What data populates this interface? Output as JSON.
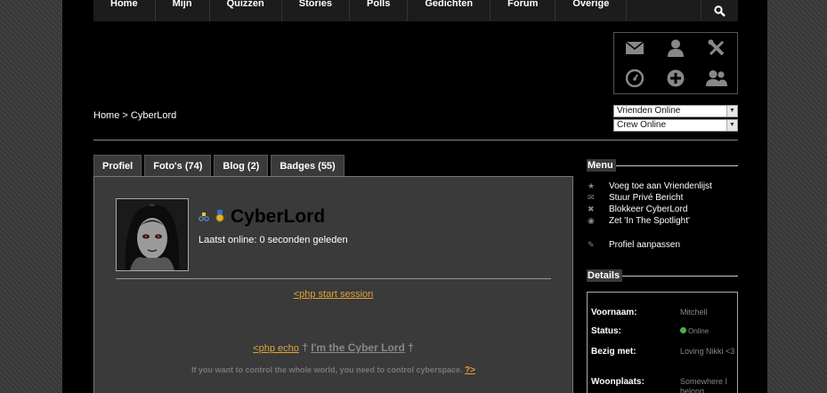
{
  "nav": {
    "items": [
      "Home",
      "Mijn",
      "Quizzen",
      "Stories",
      "Polls",
      "Gedichten",
      "Forum",
      "Overige"
    ],
    "search_icon": "search-icon"
  },
  "iconbox": {
    "icons": [
      "envelope-icon",
      "user-icon",
      "tools-icon",
      "dashboard-icon",
      "plus-circle-icon",
      "users-icon"
    ]
  },
  "breadcrumb": {
    "home": "Home",
    "separator": ">",
    "current": "CyberLord"
  },
  "selects": {
    "friends": "Vrienden Online",
    "crew": "Crew Online"
  },
  "tabs": [
    "Profiel",
    "Foto's (74)",
    "Blog (2)",
    "Badges (55)"
  ],
  "profile": {
    "username": "CyberLord",
    "last_online": "Laatst online: 0 seconden geleden",
    "php_start": "<php start session",
    "php_echo": "<php echo",
    "dagger": "†",
    "lord_text": "I'm the Cyber Lord",
    "quote": "If you want to control the whole world, you need to control cyberspace.",
    "php_end": "?>"
  },
  "sidebar": {
    "menu_title": "Menu",
    "menu_items": [
      {
        "icon": "star-icon",
        "label": "Voeg toe aan Vriendenlijst"
      },
      {
        "icon": "mail-icon",
        "label": "Stuur Privé Bericht"
      },
      {
        "icon": "block-icon",
        "label": "Blokkeer CyberLord"
      },
      {
        "icon": "eye-icon",
        "label": "Zet 'In The Spotlight'"
      },
      {
        "icon": "pencil-icon",
        "label": "Profiel aanpassen"
      }
    ],
    "details_title": "Details",
    "details": [
      {
        "key": "Voornaam:",
        "value": "Mitchell"
      },
      {
        "key": "Status:",
        "value": "Online"
      },
      {
        "key": "Bezig met:",
        "value": "Loving Nikki <3"
      },
      {
        "key": "Woonplaats:",
        "value": "Somewhere I belong"
      }
    ]
  },
  "colors": {
    "accent_link": "#e6a03a",
    "background": "#000000",
    "panel": "#3a3a3a"
  }
}
